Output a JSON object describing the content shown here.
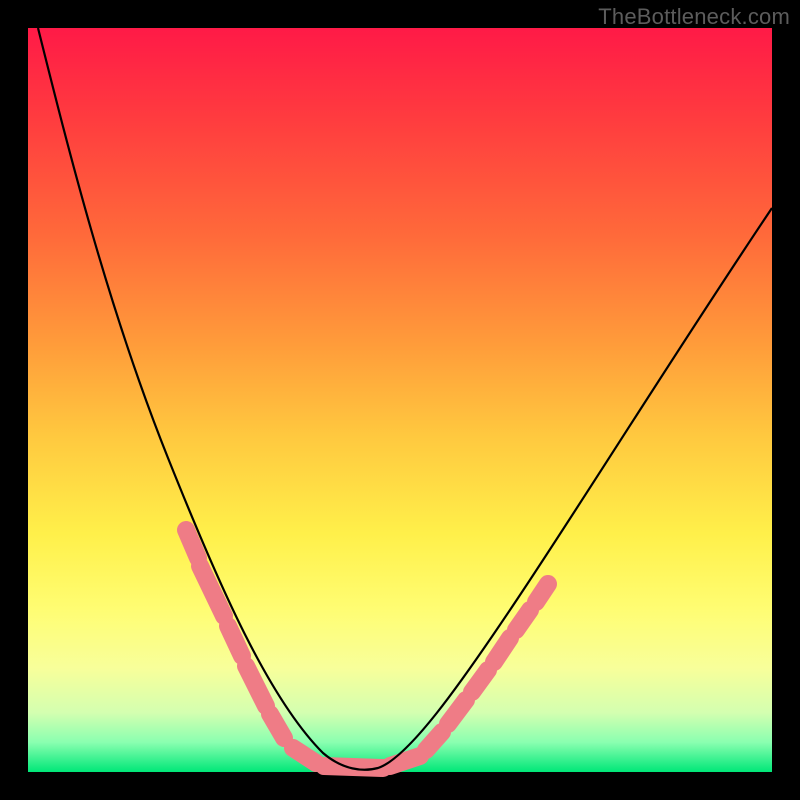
{
  "watermark": "TheBottleneck.com",
  "colors": {
    "frame": "#000000",
    "curve": "#000000",
    "beads": "#ef7c86",
    "gradient_top": "#ff1a47",
    "gradient_bottom": "#00e778"
  },
  "chart_data": {
    "type": "line",
    "title": "",
    "xlabel": "",
    "ylabel": "",
    "xlim": [
      0,
      100
    ],
    "ylim": [
      0,
      100
    ],
    "grid": false,
    "legend": false,
    "annotations": [
      "TheBottleneck.com"
    ],
    "series": [
      {
        "name": "bottleneck-curve",
        "x": [
          2,
          4,
          6,
          8,
          10,
          12,
          14,
          16,
          18,
          20,
          22,
          24,
          26,
          28,
          30,
          32,
          34,
          36,
          38,
          40,
          44,
          48,
          52,
          56,
          60,
          64,
          68,
          72,
          76,
          80,
          84,
          88,
          92,
          96,
          100
        ],
        "y": [
          100,
          92,
          84,
          77,
          70,
          63,
          57,
          51,
          45,
          40,
          35,
          30,
          25,
          21,
          17,
          13,
          9,
          6,
          3,
          1,
          0,
          2,
          6,
          11,
          17,
          23,
          29,
          35,
          41,
          47,
          53,
          59,
          65,
          71,
          77
        ]
      },
      {
        "name": "highlighted-beads-left",
        "x": [
          21,
          23,
          24,
          26,
          28,
          29,
          30,
          31,
          32,
          34
        ],
        "y": [
          34,
          29,
          27,
          22,
          18,
          15,
          12,
          10,
          8,
          5
        ]
      },
      {
        "name": "highlighted-beads-bottom",
        "x": [
          36,
          38,
          40,
          42,
          44,
          46,
          48
        ],
        "y": [
          2,
          1,
          0,
          0,
          0,
          1,
          2
        ]
      },
      {
        "name": "highlighted-beads-right",
        "x": [
          50,
          51,
          52,
          54,
          55,
          57,
          58,
          60,
          61,
          63
        ],
        "y": [
          4,
          6,
          7,
          10,
          12,
          15,
          17,
          20,
          22,
          26
        ]
      }
    ]
  }
}
